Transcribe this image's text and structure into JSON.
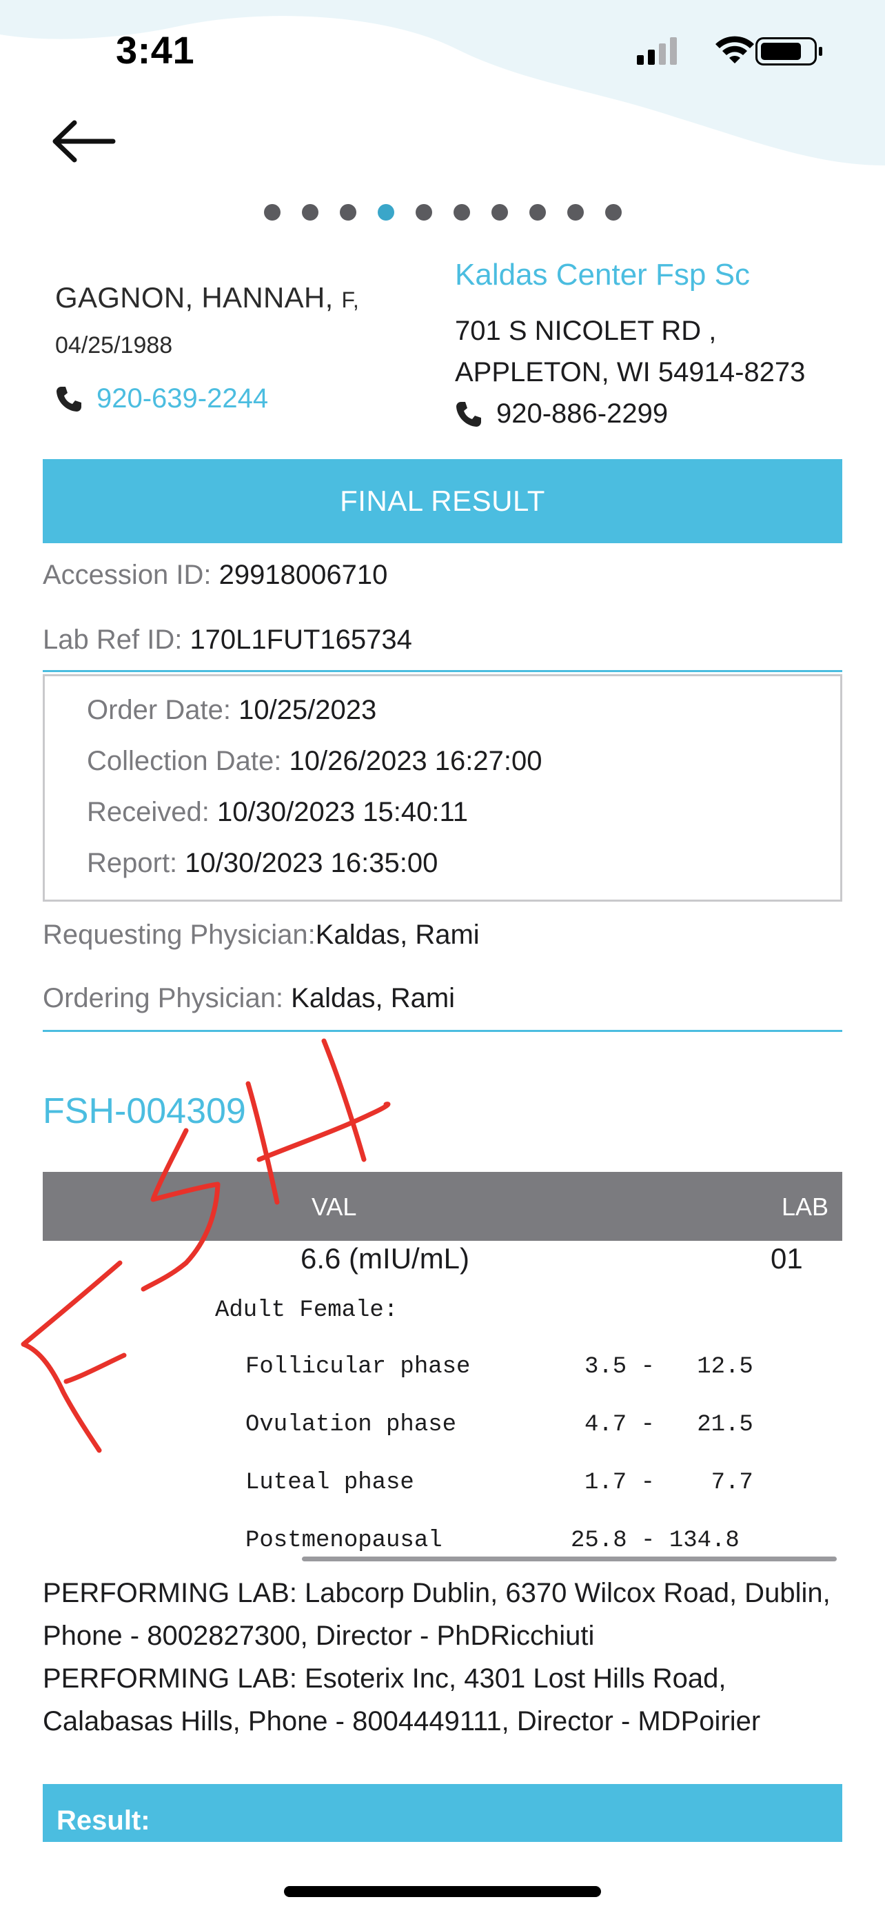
{
  "status_bar": {
    "time": "3:41"
  },
  "pager": {
    "count": 10,
    "active_index": 3
  },
  "patient": {
    "name": "GAGNON, HANNAH,",
    "sex": "F,",
    "dob": "04/25/1988",
    "phone": "920-639-2244"
  },
  "facility": {
    "name": "Kaldas Center Fsp Sc",
    "address_line1": "701 S NICOLET RD ,",
    "address_line2": "APPLETON, WI 54914-8273",
    "phone": "920-886-2299"
  },
  "banner": {
    "label": "FINAL RESULT"
  },
  "accession": {
    "label": "Accession ID: ",
    "value": "29918006710"
  },
  "lab_ref": {
    "label": "Lab Ref ID: ",
    "value": "170L1FUT165734"
  },
  "dates": {
    "order": {
      "label": "Order Date: ",
      "value": "10/25/2023"
    },
    "collection": {
      "label": "Collection Date: ",
      "value": "10/26/2023 16:27:00"
    },
    "received": {
      "label": "Received: ",
      "value": "10/30/2023 15:40:11"
    },
    "report": {
      "label": "Report: ",
      "value": "10/30/2023  16:35:00"
    }
  },
  "physicians": {
    "requesting": {
      "label": "Requesting Physician:",
      "value": "Kaldas, Rami"
    },
    "ordering": {
      "label": "Ordering Physician: ",
      "value": "Kaldas, Rami"
    }
  },
  "test": {
    "code": "FSH-004309",
    "columns": {
      "val": "VAL",
      "lab": "LAB"
    },
    "value": "6.6  (mIU/mL)",
    "lab": "01",
    "reference_header": "Adult Female:",
    "reference_ranges": [
      {
        "phase": "Follicular phase",
        "range": "3.5 -   12.5"
      },
      {
        "phase": "Ovulation phase",
        "range": "4.7 -   21.5"
      },
      {
        "phase": "Luteal phase",
        "range": "1.7 -    7.7"
      },
      {
        "phase": "Postmenopausal",
        "range": "25.8 - 134.8"
      }
    ]
  },
  "performing_labs": [
    "PERFORMING LAB: Labcorp Dublin, 6370 Wilcox Road, Dublin, Phone - 8002827300, Director - PhDRicchiuti",
    "PERFORMING LAB: Esoterix Inc, 4301 Lost Hills Road, Calabasas Hills, Phone - 8004449111, Director - MDPoirier"
  ],
  "result_section": {
    "label": "Result:"
  },
  "colors": {
    "accent": "#4bbde0",
    "pager_active": "#3aa6c9",
    "table_header": "#7b7b7f",
    "annotation": "#e8322a"
  },
  "icons": [
    "back-arrow-icon",
    "phone-icon",
    "signal-icon",
    "wifi-icon",
    "battery-icon"
  ]
}
